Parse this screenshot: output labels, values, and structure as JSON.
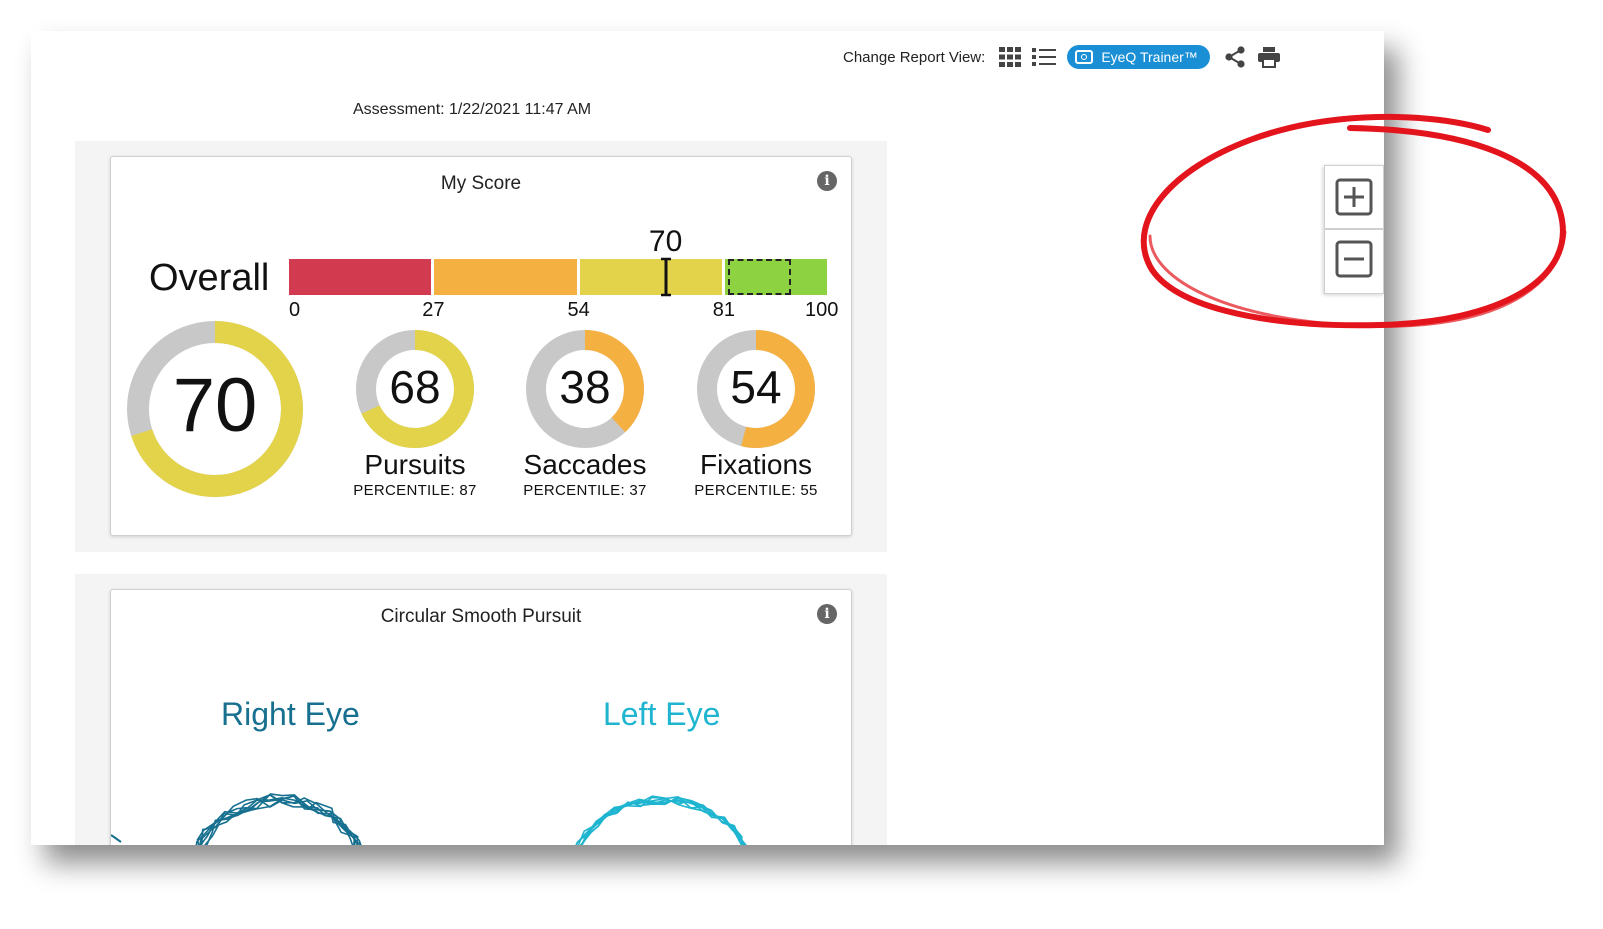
{
  "toolbar": {
    "change_view_label": "Change Report View:",
    "grid_view_icon": "grid-view-icon",
    "list_view_icon": "list-view-icon",
    "trainer_label": "EyeQ Trainer™",
    "share_icon": "share-icon",
    "print_icon": "print-icon"
  },
  "assessment": "Assessment: 1/22/2021 11:47 AM",
  "my_score": {
    "title": "My Score",
    "overall_label": "Overall",
    "overall_value": 70,
    "overall_value_text": "70",
    "scale_ticks": [
      "0",
      "27",
      "54",
      "81",
      "100"
    ],
    "scale_ranges": [
      {
        "from": 0,
        "to": 27,
        "color": "#d23a4f"
      },
      {
        "from": 27,
        "to": 54,
        "color": "#f5b042"
      },
      {
        "from": 54,
        "to": 81,
        "color": "#e2d34a"
      },
      {
        "from": 81,
        "to": 100,
        "color": "#8dd240"
      }
    ],
    "main_score": {
      "value": 70,
      "text": "70",
      "color": "#e2d34a"
    },
    "sub_scores": [
      {
        "value": 68,
        "text": "68",
        "name": "Pursuits",
        "percentile": "PERCENTILE: 87",
        "color": "#e2d34a"
      },
      {
        "value": 38,
        "text": "38",
        "name": "Saccades",
        "percentile": "PERCENTILE: 37",
        "color": "#f5b042"
      },
      {
        "value": 54,
        "text": "54",
        "name": "Fixations",
        "percentile": "PERCENTILE: 55",
        "color": "#f5b042"
      }
    ]
  },
  "pursuit": {
    "title": "Circular Smooth Pursuit",
    "right_eye": "Right Eye",
    "left_eye": "Left Eye",
    "right_color": "#17708f",
    "left_color": "#1fb5d0"
  },
  "zoom": {
    "zoom_in_icon": "zoom-in-icon",
    "zoom_out_icon": "zoom-out-icon"
  },
  "annotation_color": "#e3141b"
}
